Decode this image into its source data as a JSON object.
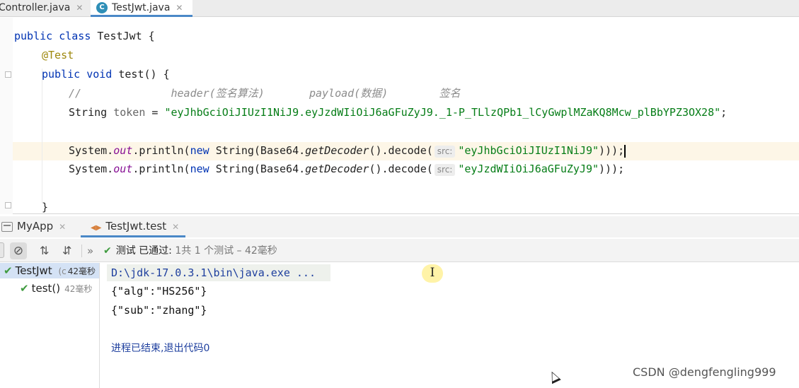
{
  "editor_tabs": [
    {
      "label": "Controller.java",
      "active": false
    },
    {
      "label": "TestJwt.java",
      "active": true
    }
  ],
  "code": {
    "kw_public": "public",
    "kw_class": "class",
    "class_name": "TestJwt",
    "open_brace": "{",
    "annotation": "@Test",
    "kw_void": "void",
    "method_sig": "test()",
    "comment": "//              header(签名算法)       payload(数据)        签名",
    "type_string": "String",
    "var_token": "token",
    "assign": "=",
    "token_value": "\"eyJhbGciOiJIUzI1NiJ9.eyJzdWIiOiJ6aGFuZyJ9._1-P_TLlzQPb1_lCyGwplMZaKQ8Mcw_plBbYPZ3OX28\"",
    "semicolon": ";",
    "sys": "System.",
    "out": "out",
    "println_open": ".println(",
    "kw_new": "new",
    "string_ctor": "String(Base64.",
    "get_decoder": "getDecoder",
    "decode_open": "().decode(",
    "param_hint": "src:",
    "arg1": "\"eyJhbGciOiJIUzI1NiJ9\"",
    "arg2": "\"eyJzdWIiOiJ6aGFuZyJ9\"",
    "close_parens": ")));",
    "close_brace": "}"
  },
  "run_tabs": [
    {
      "label": "MyApp"
    },
    {
      "label": "TestJwt.test"
    }
  ],
  "toolbar": {
    "more": "»",
    "status_main": "测试 已通过:",
    "status_count": "1共 1 个测试 – 42毫秒"
  },
  "test_tree": [
    {
      "label": "TestJwt",
      "detail": "(c",
      "duration": "42毫秒"
    },
    {
      "label": "test()",
      "duration": "42毫秒"
    }
  ],
  "console": {
    "command": "D:\\jdk-17.0.3.1\\bin\\java.exe ...",
    "output": [
      "{\"alg\":\"HS256\"}",
      "{\"sub\":\"zhang\"}"
    ],
    "exit_message": "进程已结束,退出代码0"
  },
  "watermark": "CSDN @dengfengling999",
  "colors": {
    "keyword": "#0033b3",
    "string": "#067d17",
    "annotation": "#9e880d",
    "comment": "#8c8c8c",
    "pass": "#3f9b3f",
    "accent": "#4a88c7"
  },
  "icons": [
    "java-class-icon",
    "close-icon",
    "app-icon",
    "test-icon",
    "stop-icon",
    "sort-alpha-icon",
    "sort-duration-icon",
    "check-icon",
    "text-cursor-icon",
    "mouse-pointer-icon"
  ]
}
